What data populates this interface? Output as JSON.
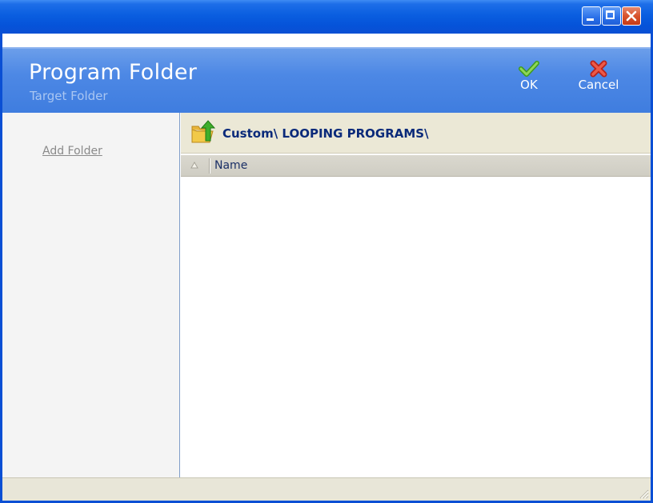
{
  "header": {
    "title": "Program Folder",
    "subtitle": "Target Folder",
    "ok_label": "OK",
    "cancel_label": "Cancel"
  },
  "sidebar": {
    "add_folder_label": "Add Folder"
  },
  "browser": {
    "path": "Custom\\ LOOPING PROGRAMS\\",
    "columns": [
      "Name"
    ],
    "rows": []
  },
  "colors": {
    "titlebar": "#0a5ee0",
    "header": "#4d88e5",
    "ok_icon": "#5cb82a",
    "cancel_icon": "#d83a2a",
    "path_text": "#0a2a7a"
  },
  "icons": [
    "minimize-icon",
    "maximize-icon",
    "close-icon",
    "check-icon",
    "x-icon",
    "folder-up-icon",
    "sort-arrow-icon",
    "resize-grip-icon"
  ]
}
